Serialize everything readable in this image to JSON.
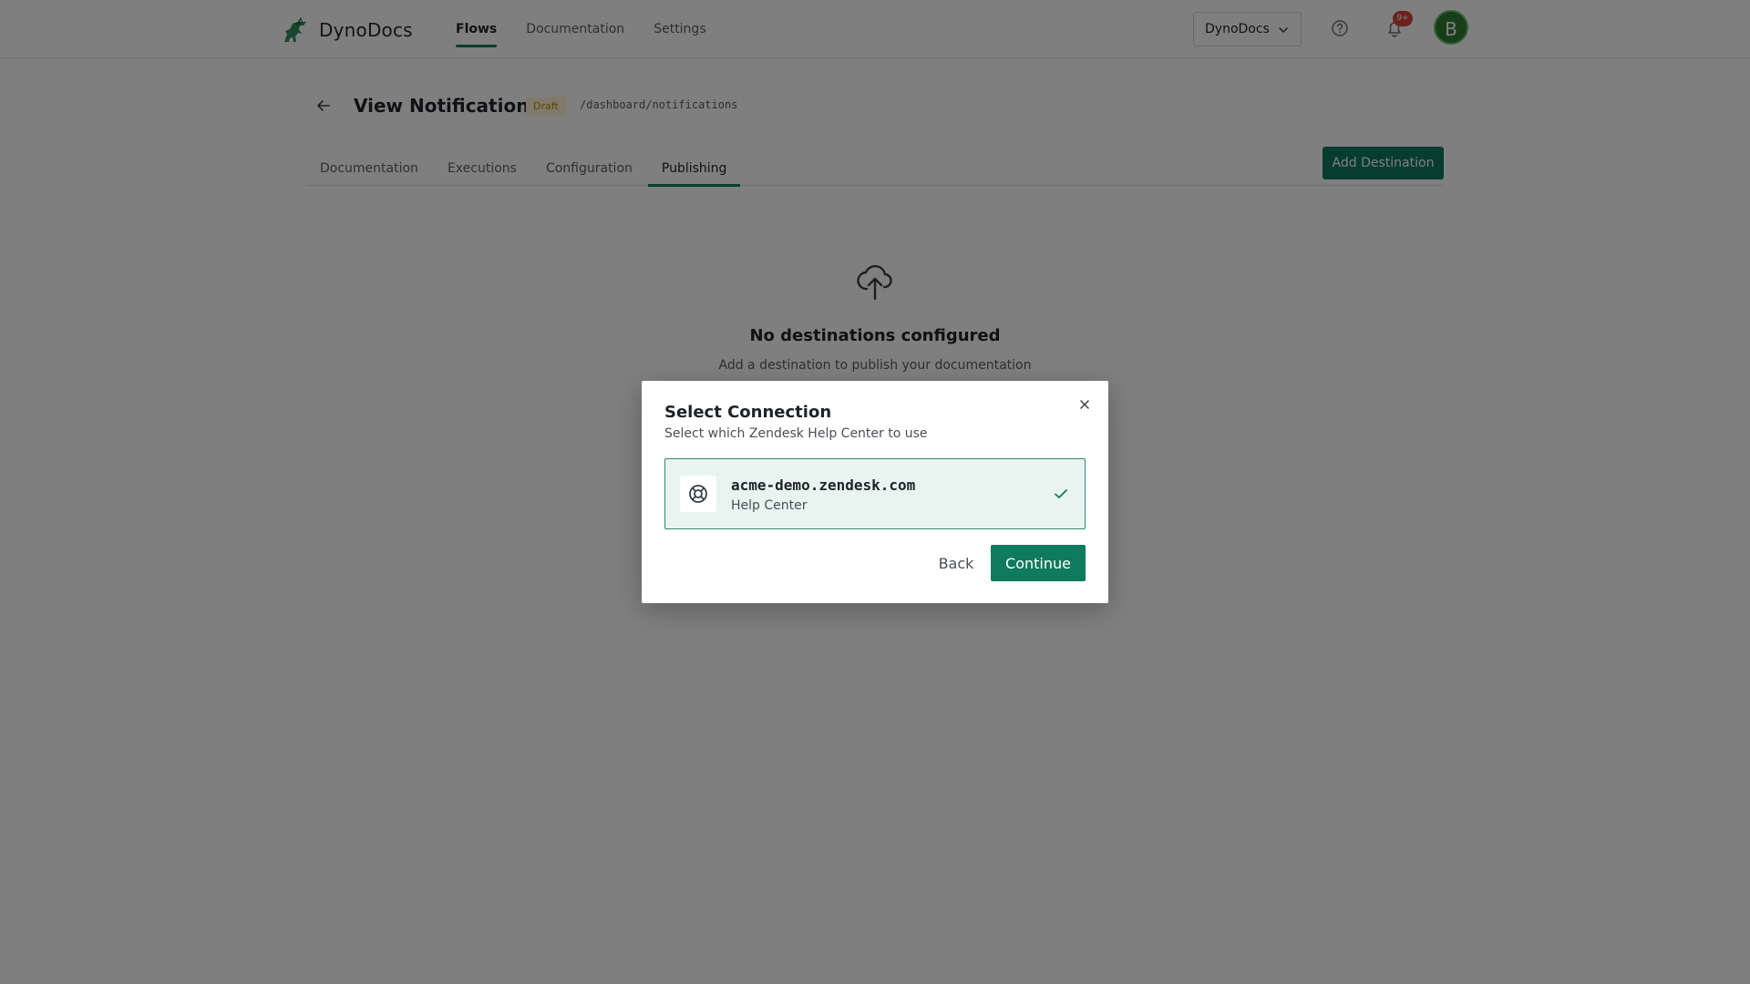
{
  "brand": {
    "name": "DynoDocs"
  },
  "nav": {
    "items": [
      {
        "label": "Flows",
        "active": true
      },
      {
        "label": "Documentation",
        "active": false
      },
      {
        "label": "Settings",
        "active": false
      }
    ]
  },
  "header": {
    "workspace": "DynoDocs",
    "notification_badge": "9+",
    "avatar_initial": "B"
  },
  "page": {
    "title": "View Notifications",
    "status_badge": "Draft",
    "route": "/dashboard/notifications",
    "tabs": [
      {
        "label": "Documentation"
      },
      {
        "label": "Executions"
      },
      {
        "label": "Configuration"
      },
      {
        "label": "Publishing",
        "active": true
      }
    ],
    "add_destination_label": "Add Destination"
  },
  "empty_state": {
    "title": "No destinations configured",
    "subtitle": "Add a destination to publish your documentation"
  },
  "modal": {
    "title": "Select Connection",
    "subtitle": "Select which Zendesk Help Center to use",
    "connection": {
      "name": "acme-demo.zendesk.com",
      "type": "Help Center",
      "selected": true
    },
    "back_label": "Back",
    "continue_label": "Continue"
  },
  "colors": {
    "accent": "#0f7a5c",
    "selected_bg": "#e8f4f0",
    "badge_red": "#d6453a",
    "draft_text": "#c58a00"
  }
}
